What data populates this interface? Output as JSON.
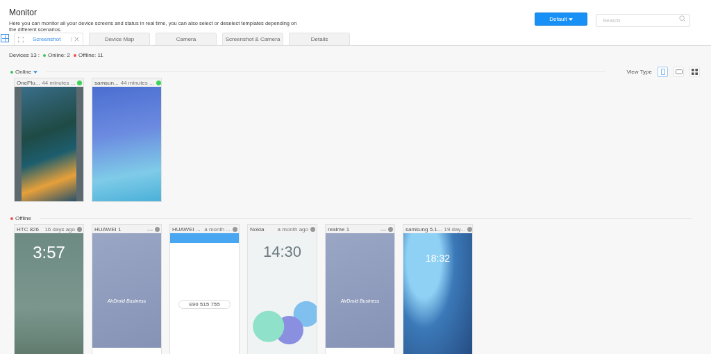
{
  "header": {
    "title": "Monitor",
    "description": "Here you can monitor all your device screens and status in real time, you can also select or deselect templates depending on the different scenarios.",
    "template_button": "Default",
    "search": {
      "placeholder": "Search"
    }
  },
  "tabs": [
    {
      "label": "Screenshot",
      "selected": true
    },
    {
      "label": "Device Map",
      "selected": false
    },
    {
      "label": "Camera",
      "selected": false
    },
    {
      "label": "Screenshot & Camera",
      "selected": false
    },
    {
      "label": "Details",
      "selected": false
    }
  ],
  "summary": {
    "devices": "Devices 13 :",
    "online": "Online: 2",
    "offline": "Offline: 11"
  },
  "view_type": {
    "label": "View Type",
    "options": [
      {
        "kind": "phone",
        "selected": true
      },
      {
        "kind": "tablet",
        "selected": false
      },
      {
        "kind": "grid",
        "selected": false
      }
    ]
  },
  "groups": [
    {
      "label": "Online",
      "online": true,
      "devices": [
        {
          "name": "OnePlu...",
          "time": "44 minutes ...",
          "online": true,
          "screen": {
            "kind": "wallpaper"
          }
        },
        {
          "name": "samsun...",
          "time": "44 minutes ...",
          "online": true,
          "screen": {
            "kind": "homescreen"
          }
        }
      ]
    },
    {
      "label": "Offline",
      "online": false,
      "devices": [
        {
          "name": "HTC 826",
          "time": "16 days ago",
          "online": false,
          "screen": {
            "kind": "lock",
            "caption": "3:57"
          }
        },
        {
          "name": "HUAWEI 1",
          "time": "—",
          "online": false,
          "screen": {
            "kind": "brand",
            "caption": "AirDroid Business"
          }
        },
        {
          "name": "HUAWEI ...",
          "time": "a month ...",
          "online": false,
          "screen": {
            "kind": "app",
            "caption": "690 515 755"
          }
        },
        {
          "name": "Nokia",
          "time": "a month ago",
          "online": false,
          "screen": {
            "kind": "bubbles",
            "caption": "14:30"
          }
        },
        {
          "name": "realme 1",
          "time": "—",
          "online": false,
          "screen": {
            "kind": "brand",
            "caption": "AirDroid Business"
          }
        },
        {
          "name": "samsung 5.1...",
          "time": "19 day...",
          "online": false,
          "screen": {
            "kind": "tablet-lock",
            "caption": "18:32"
          }
        }
      ]
    }
  ]
}
